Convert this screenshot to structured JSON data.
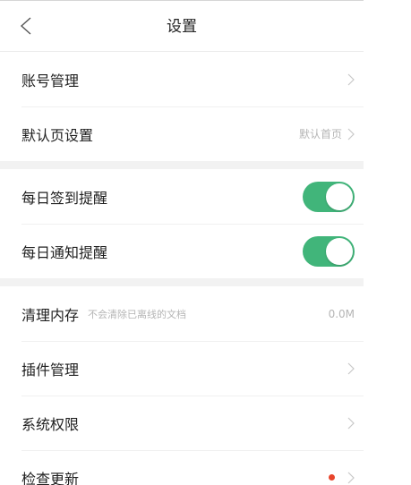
{
  "header": {
    "title": "设置",
    "back_icon": "chevron-left-icon"
  },
  "colors": {
    "toggle_on": "#41b57a",
    "update_dot": "#e8452c"
  },
  "section1": {
    "account": {
      "label": "账号管理"
    },
    "default_page": {
      "label": "默认页设置",
      "value": "默认首页"
    }
  },
  "section2": {
    "daily_checkin": {
      "label": "每日签到提醒",
      "enabled": true
    },
    "daily_notice": {
      "label": "每日通知提醒",
      "enabled": true
    }
  },
  "section3": {
    "clear_cache": {
      "label": "清理内存",
      "hint": "不会清除已离线的文档",
      "value": "0.0M"
    },
    "plugins": {
      "label": "插件管理"
    },
    "permissions": {
      "label": "系统权限"
    },
    "check_update": {
      "label": "检查更新",
      "has_badge": true
    }
  }
}
